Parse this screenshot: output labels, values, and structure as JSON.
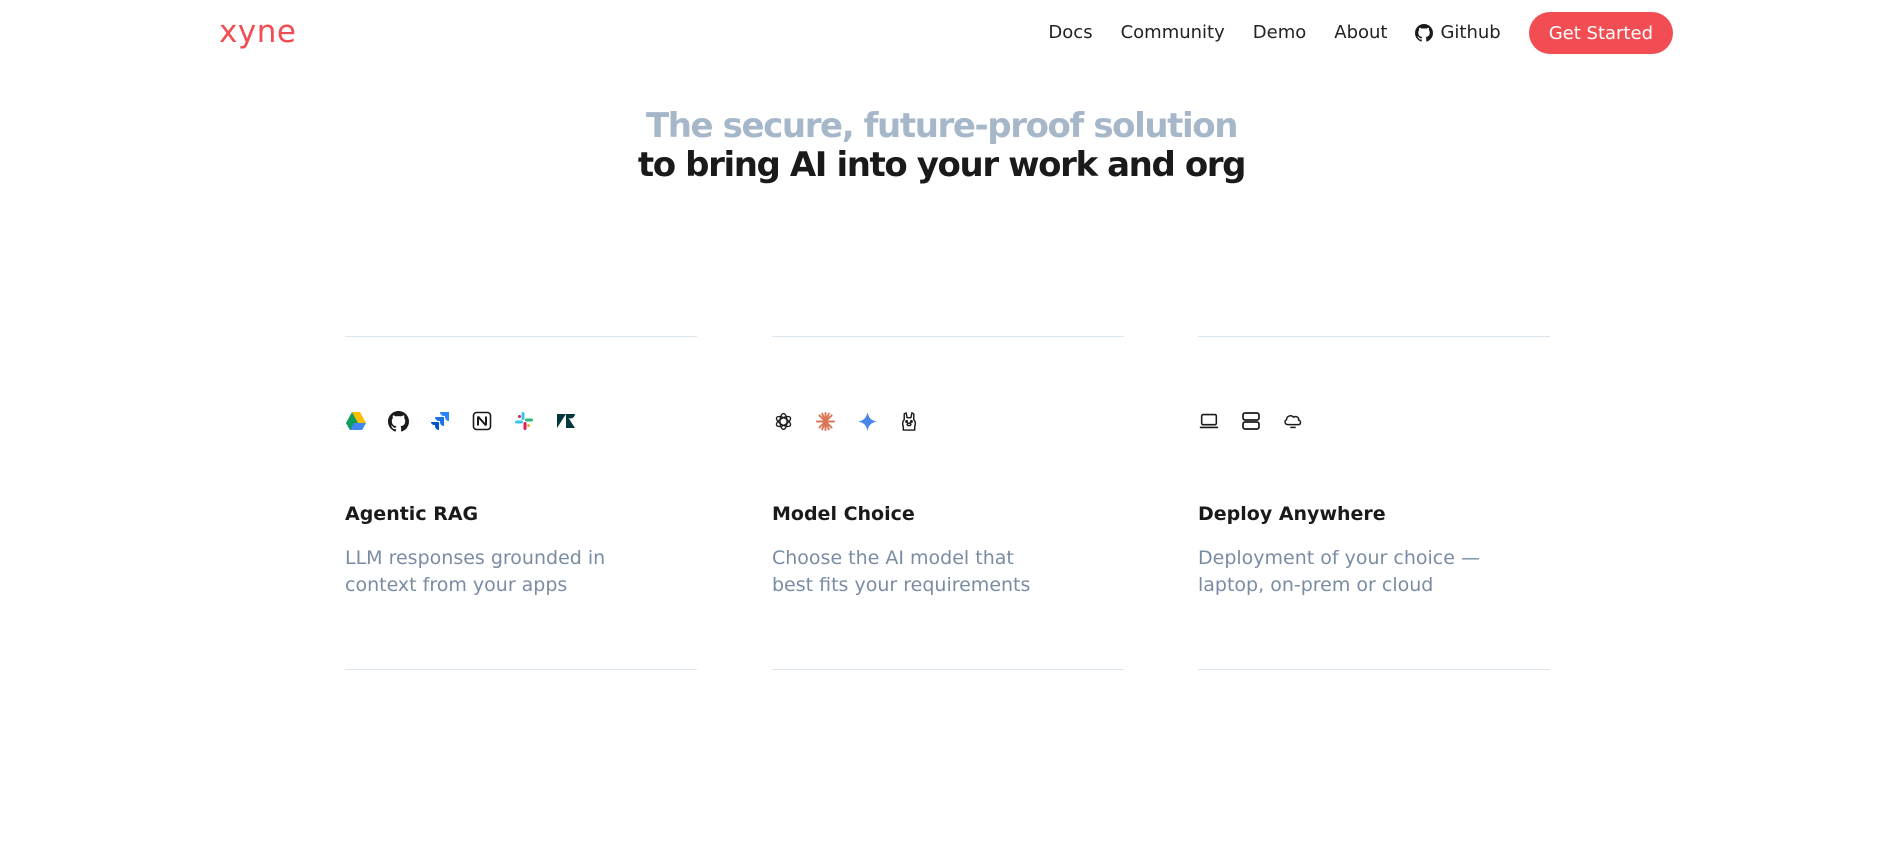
{
  "header": {
    "logo": "xyne",
    "nav": [
      "Docs",
      "Community",
      "Demo",
      "About"
    ],
    "github_label": "Github",
    "cta_label": "Get Started"
  },
  "hero": {
    "line1": "The secure, future-proof solution",
    "line2": "to bring AI into your work and org"
  },
  "features": [
    {
      "title": "Agentic RAG",
      "desc_line1": "LLM responses grounded in",
      "desc_line2": "context from your apps",
      "icons": [
        "google-drive-icon",
        "github-icon",
        "jira-icon",
        "notion-icon",
        "slack-icon",
        "zendesk-icon"
      ]
    },
    {
      "title": "Model Choice",
      "desc_line1": "Choose the AI model that",
      "desc_line2": "best fits your requirements",
      "icons": [
        "openai-icon",
        "anthropic-icon",
        "gemini-icon",
        "ollama-icon"
      ]
    },
    {
      "title": "Deploy Anywhere",
      "desc_line1": "Deployment of your choice —",
      "desc_line2": "laptop, on-prem or cloud",
      "icons": [
        "laptop-icon",
        "server-icon",
        "cloud-icon"
      ]
    }
  ],
  "colors": {
    "brand": "#f24d52",
    "hero_muted": "#a5b7c8",
    "desc_text": "#7a8ca3",
    "rule": "#dce6ee"
  }
}
